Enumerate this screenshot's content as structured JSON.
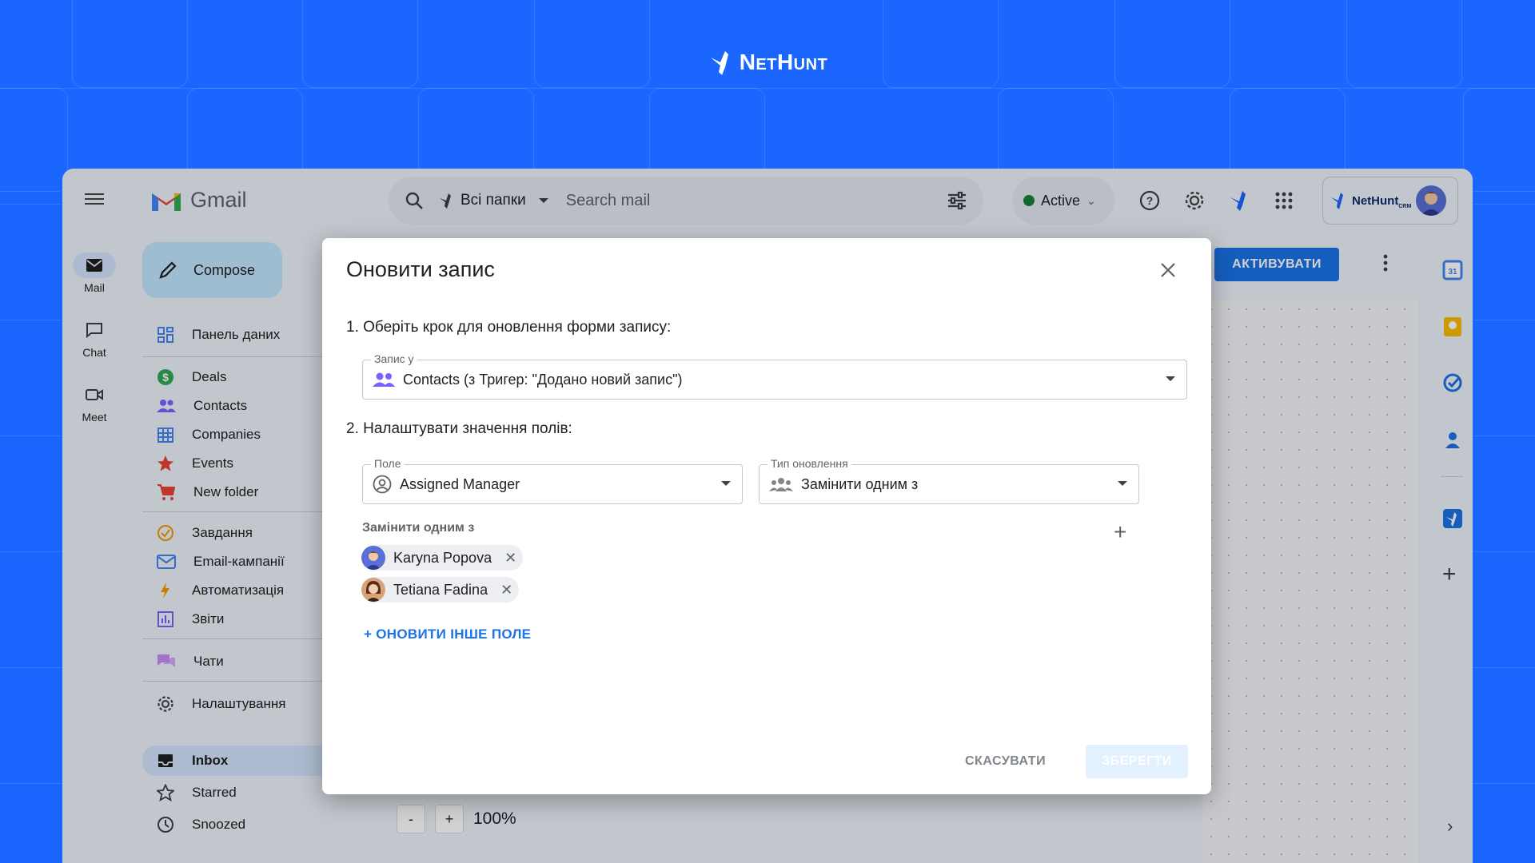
{
  "brand": {
    "name": "NetHunt"
  },
  "gmail": {
    "app_name": "Gmail",
    "search": {
      "folder": "Всі папки",
      "placeholder": "Search mail"
    },
    "status": "Active",
    "account": {
      "crm_name": "NetHunt",
      "crm_sub": "CRM"
    },
    "rail": [
      {
        "label": "Mail",
        "icon": "mail-icon",
        "active": true
      },
      {
        "label": "Chat",
        "icon": "chat-icon"
      },
      {
        "label": "Meet",
        "icon": "video-icon"
      }
    ],
    "compose_label": "Compose",
    "nav": {
      "dashboard": "Панель даних",
      "folders": [
        {
          "label": "Deals",
          "icon": "dollar-icon",
          "color": "#34a853"
        },
        {
          "label": "Contacts",
          "icon": "people-icon",
          "color": "#7b61ff"
        },
        {
          "label": "Companies",
          "icon": "building-icon",
          "color": "#4285f4"
        },
        {
          "label": "Events",
          "icon": "star-icon",
          "color": "#ea4335"
        },
        {
          "label": "New folder",
          "icon": "cart-icon",
          "color": "#ea4335"
        }
      ],
      "tools": [
        {
          "label": "Завдання",
          "icon": "task-check-icon",
          "color": "#f29900"
        },
        {
          "label": "Email-кампанії",
          "icon": "email-campaign-icon",
          "color": "#4285f4"
        },
        {
          "label": "Автоматизація",
          "icon": "lightning-icon",
          "color": "#f29900"
        },
        {
          "label": "Звіти",
          "icon": "report-icon",
          "color": "#7b61ff"
        }
      ],
      "chats": "Чати",
      "settings": "Налаштування",
      "mailboxes": [
        {
          "label": "Inbox",
          "icon": "inbox-icon",
          "active": true
        },
        {
          "label": "Starred",
          "icon": "star-outline-icon"
        },
        {
          "label": "Snoozed",
          "icon": "clock-icon"
        }
      ]
    },
    "activate_label": "АКТИВУВАТИ",
    "zoom": {
      "minus": "-",
      "plus": "+",
      "level": "100%"
    }
  },
  "modal": {
    "title": "Оновити запис",
    "step1": "1. Оберіть крок для оновлення форми запису:",
    "record_in": {
      "label": "Запис у",
      "value": "Contacts (з Тригер: \"Додано новий запис\")"
    },
    "step2": "2. Налаштувати значення полів:",
    "field": {
      "label": "Поле",
      "value": "Assigned Manager"
    },
    "update_type": {
      "label": "Тип оновлення",
      "value": "Замінити одним з"
    },
    "replace_label": "Замінити одним з",
    "users": [
      {
        "name": "Karyna Popova",
        "color": "#6a4bd8"
      },
      {
        "name": "Tetiana Fadina",
        "color": "#8c4a2f"
      }
    ],
    "add_field": "+ ОНОВИТИ ІНШЕ ПОЛЕ",
    "cancel": "СКАСУВАТИ",
    "save": "ЗБЕРЕГТИ"
  }
}
